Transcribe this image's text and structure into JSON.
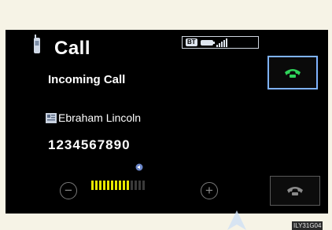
{
  "header": {
    "title": "Call",
    "phone_icon": "mobile-phone-icon"
  },
  "status": {
    "bt_label": "BT",
    "battery_icon": "battery-icon",
    "signal_icon": "signal-strength-icon"
  },
  "call": {
    "status_text": "Incoming Call",
    "caller_name": "Ebraham Lincoln",
    "caller_number": "1234567890",
    "contact_icon": "contact-card-icon"
  },
  "volume": {
    "level": 10,
    "max": 14,
    "minus_label": "−",
    "plus_label": "+",
    "speaker_icon": "speaker-icon"
  },
  "buttons": {
    "answer_icon": "answer-call-icon",
    "end_icon": "end-call-icon"
  },
  "figure_code": "ILY31G04",
  "colors": {
    "answer_green": "#2fd35a",
    "volume_active": "#e8e800",
    "volume_inactive": "#3a3a3a",
    "answer_border": "#7fb3ff"
  }
}
